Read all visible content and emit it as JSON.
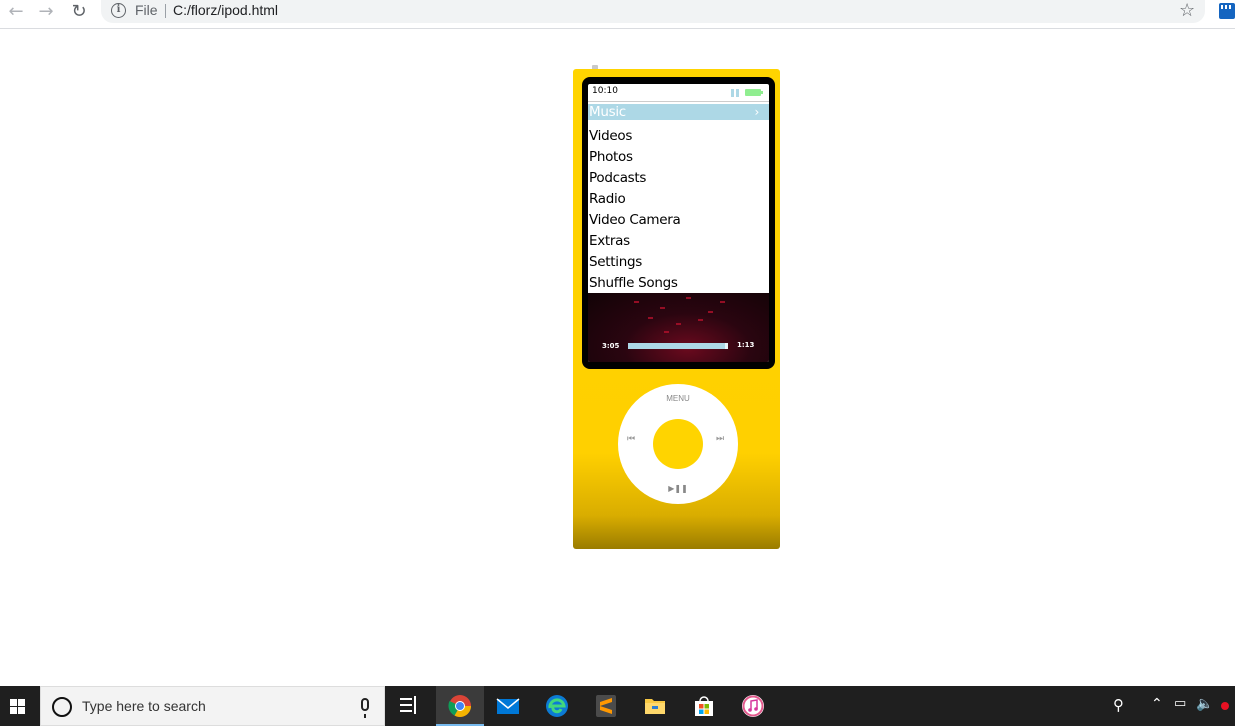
{
  "browser": {
    "scheme_label": "File",
    "url": "C:/florz/ipod.html",
    "back_icon": "arrow-left-icon",
    "forward_icon": "arrow-right-icon",
    "reload_icon": "reload-icon",
    "star_icon": "star-icon"
  },
  "ipod": {
    "body_color": "#ffd400",
    "highlight_color": "#add8e6",
    "status": {
      "time": "10:10"
    },
    "menu": {
      "selected": "Music",
      "items": [
        "Videos",
        "Photos",
        "Podcasts",
        "Radio",
        "Video Camera",
        "Extras",
        "Settings",
        "Shuffle Songs"
      ]
    },
    "now_playing": {
      "elapsed": "3:05",
      "remaining": "1:13",
      "progress": 0.97
    },
    "wheel": {
      "menu_label": "MENU",
      "prev_icon": "⏮",
      "next_icon": "⏭",
      "play_pause_icon": "▶❚❚"
    }
  },
  "taskbar": {
    "search_placeholder": "Type here to search",
    "apps": [
      "chrome-icon",
      "mail-icon",
      "edge-icon",
      "sublime-text-icon",
      "file-explorer-icon",
      "store-icon",
      "itunes-icon"
    ]
  }
}
